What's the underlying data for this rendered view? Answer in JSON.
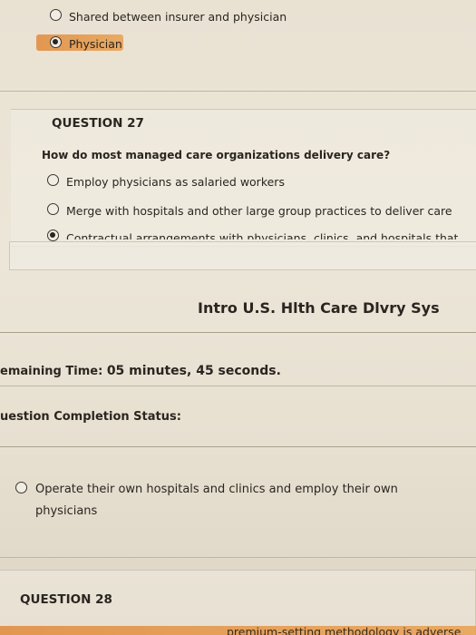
{
  "q26": {
    "options": [
      {
        "label": "Shared between insurer and physician",
        "selected": false
      },
      {
        "label": "Physician",
        "selected": true
      }
    ]
  },
  "q27": {
    "heading": "QUESTION 27",
    "prompt": "How do most managed care organizations delivery care?",
    "options": [
      {
        "label": "Employ physicians as salaried workers",
        "selected": false
      },
      {
        "label": "Merge with hospitals and other large group practices to deliver care",
        "selected": false
      },
      {
        "label": "Contractual arrangements with physicians, clinics, and hospitals that",
        "selected": true
      }
    ]
  },
  "course": {
    "title": "Intro U.S. Hlth Care Dlvry Sys"
  },
  "timer": {
    "label": "emaining Time:",
    "value": "05 minutes, 45 seconds."
  },
  "completion": {
    "label": "uestion Completion Status:"
  },
  "next_option": {
    "line1": "Operate their own hospitals and clinics and employ their own",
    "line2": "physicians"
  },
  "q28": {
    "heading": "QUESTION 28",
    "preview": "premium-setting methodology is adverse"
  },
  "colors": {
    "highlight": "#e08a3a"
  }
}
